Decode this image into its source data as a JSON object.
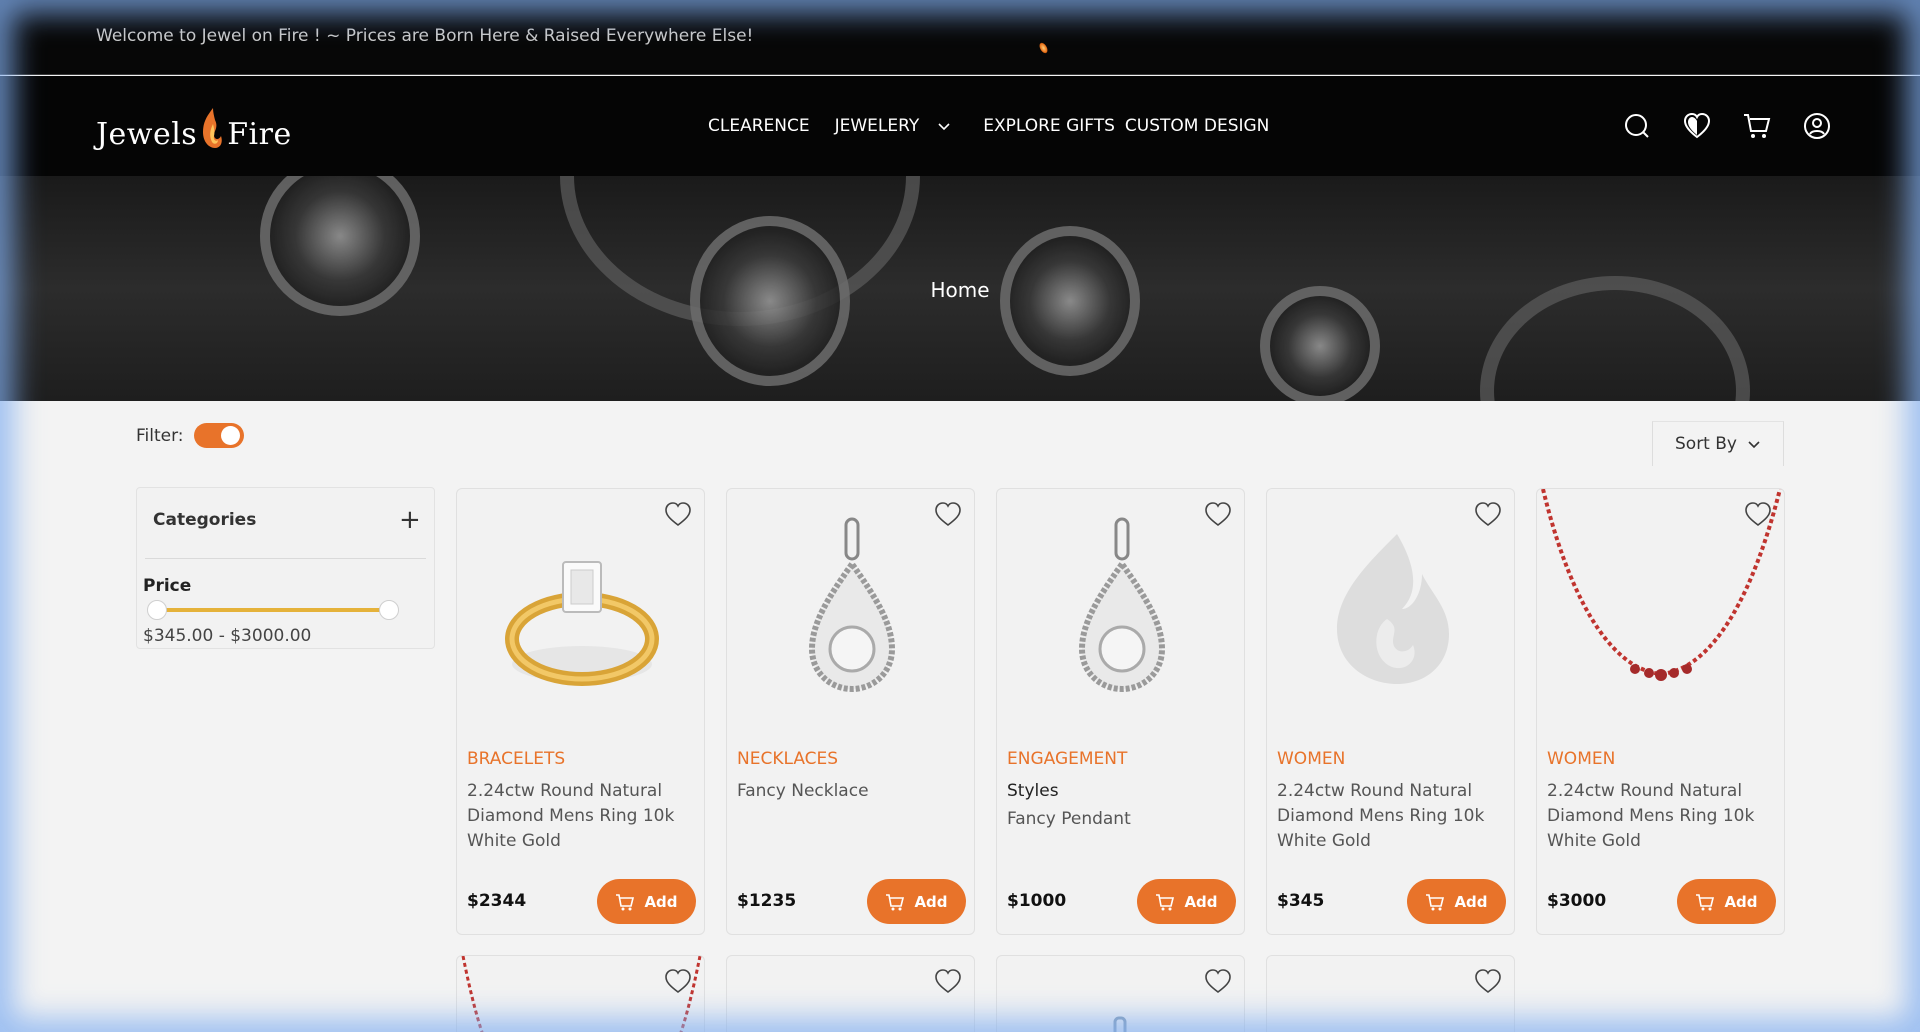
{
  "topbar": {
    "welcome": "Welcome to Jewel on Fire ! ~ Prices are Born Here & Raised Everywhere Else!"
  },
  "logo": {
    "left_word": "Jewels",
    "right_word": "Fire"
  },
  "nav": {
    "items": [
      {
        "label": "CLEARENCE"
      },
      {
        "label": "JEWELERY"
      },
      {
        "label": "EXPLORE GIFTS"
      },
      {
        "label": "CUSTOM DESIGN"
      }
    ]
  },
  "header_icons": [
    "search-icon",
    "heart-icon",
    "cart-icon",
    "user-icon"
  ],
  "hero": {
    "breadcrumb": "Home"
  },
  "filter": {
    "label": "Filter:",
    "enabled": true
  },
  "sort": {
    "label": "Sort By"
  },
  "sidebar": {
    "categories_label": "Categories",
    "price_label": "Price",
    "price_range": "$345.00 - $3000.00",
    "price_min": 345,
    "price_max": 3000
  },
  "products": [
    {
      "category": "BRACELETS",
      "name": "2.24ctw Round Natural Diamond Mens Ring 10k White Gold",
      "price": "$2344",
      "add_label": "Add",
      "image": "gold-ring"
    },
    {
      "category": "NECKLACES",
      "name": "Fancy Necklace",
      "price": "$1235",
      "add_label": "Add",
      "image": "teardrop-pendant"
    },
    {
      "category": "ENGAGEMENT",
      "name": "Styles",
      "subname": "Fancy Pendant",
      "price": "$1000",
      "add_label": "Add",
      "image": "teardrop-pendant"
    },
    {
      "category": "WOMEN",
      "name": "2.24ctw Round Natural Diamond Mens Ring 10k White Gold",
      "price": "$345",
      "add_label": "Add",
      "image": "flame-placeholder"
    },
    {
      "category": "WOMEN",
      "name": "2.24ctw Round Natural Diamond Mens Ring 10k White Gold",
      "price": "$3000",
      "add_label": "Add",
      "image": "ruby-tennis-necklace"
    }
  ],
  "colors": {
    "accent": "#e8732a",
    "slider": "#e5b23a",
    "header_bg": "#050505"
  }
}
